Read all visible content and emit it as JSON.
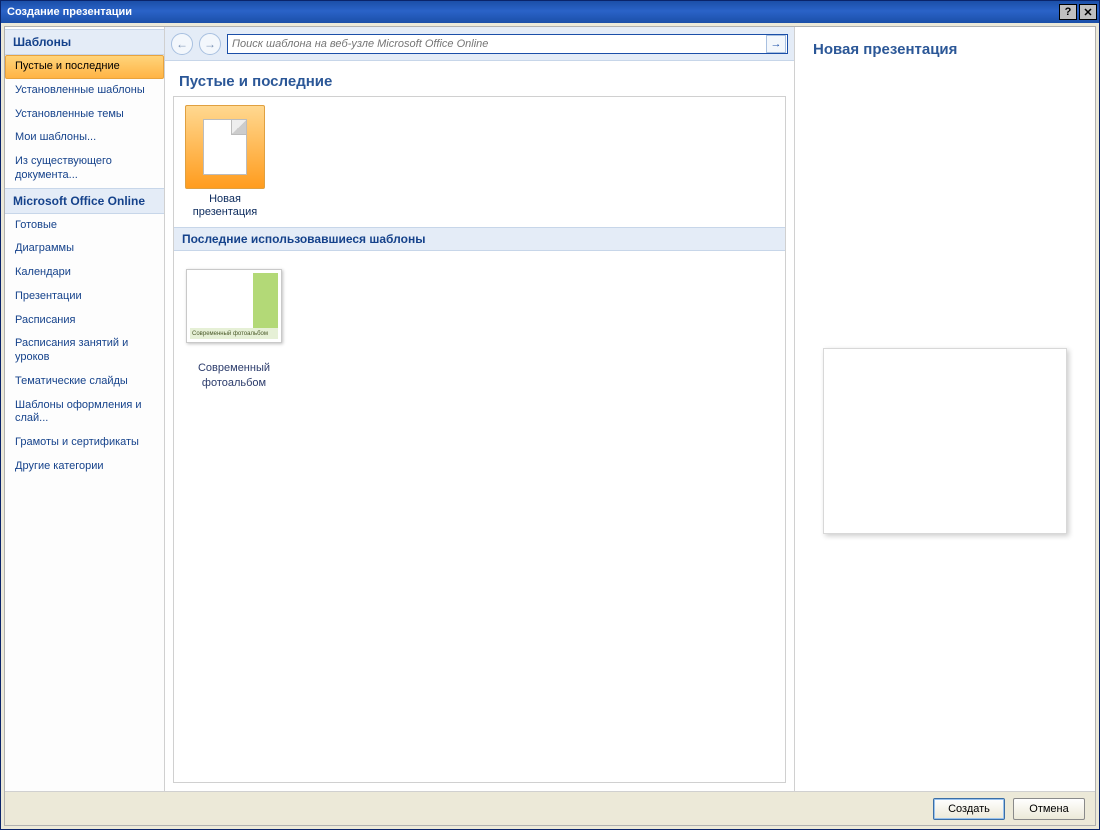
{
  "window": {
    "title": "Создание презентации",
    "help_icon": "?",
    "close_icon": "✕"
  },
  "sidebar": {
    "section_templates": "Шаблоны",
    "section_online": "Microsoft Office Online",
    "items_templates": [
      {
        "label": "Пустые и последние",
        "selected": true
      },
      {
        "label": "Установленные шаблоны"
      },
      {
        "label": "Установленные темы"
      },
      {
        "label": "Мои шаблоны..."
      },
      {
        "label": "Из существующего документа..."
      }
    ],
    "items_online": [
      {
        "label": "Готовые"
      },
      {
        "label": "Диаграммы"
      },
      {
        "label": "Календари"
      },
      {
        "label": "Презентации"
      },
      {
        "label": "Расписания"
      },
      {
        "label": "Расписания занятий и уроков"
      },
      {
        "label": "Тематические слайды"
      },
      {
        "label": "Шаблоны оформления и слай..."
      },
      {
        "label": "Грамоты и сертификаты"
      },
      {
        "label": "Другие категории"
      }
    ]
  },
  "toolbar": {
    "search_placeholder": "Поиск шаблона на веб-узле Microsoft Office Online"
  },
  "main": {
    "section_title": "Пустые и последние",
    "new_presentation_label": "Новая презентация",
    "recent_header": "Последние использовавшиеся шаблоны",
    "recent_items": [
      {
        "label": "Современный фотоальбом",
        "thumb_caption": "Современный фотоальбом"
      }
    ]
  },
  "preview": {
    "title": "Новая презентация"
  },
  "footer": {
    "create": "Создать",
    "cancel": "Отмена"
  }
}
